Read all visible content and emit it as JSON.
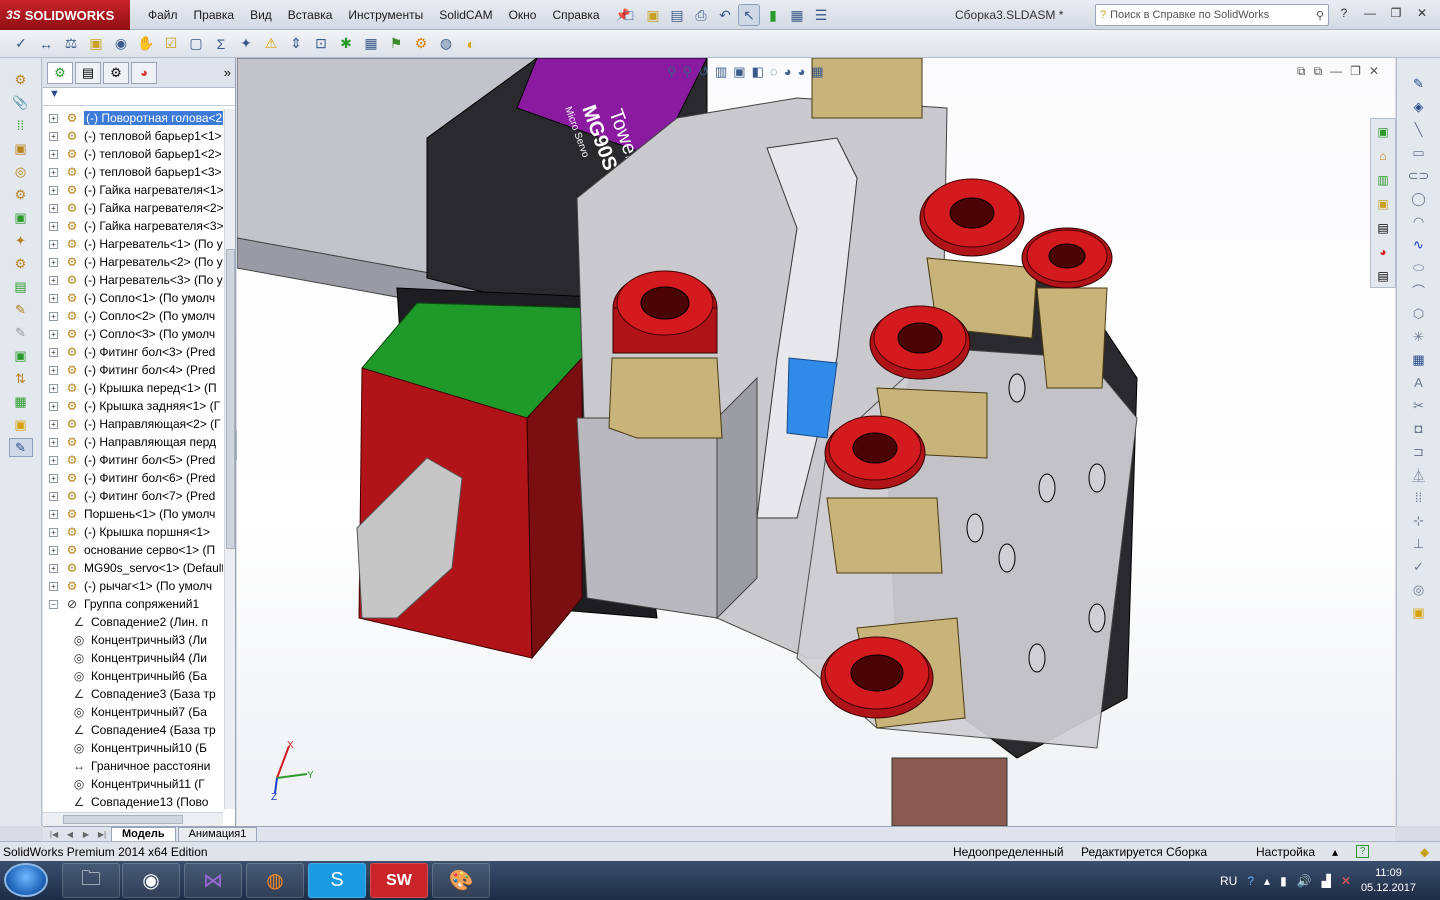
{
  "app": {
    "brand": "SOLIDWORKS",
    "brand_prefix": "3S",
    "document_title": "Сборка3.SLDASM *"
  },
  "menu": [
    "Файл",
    "Правка",
    "Вид",
    "Вставка",
    "Инструменты",
    "SolidCAM",
    "Окно",
    "Справка"
  ],
  "help_search": {
    "placeholder": "Поиск в Справке по SolidWorks"
  },
  "tree": {
    "filter_icon": "funnel-icon",
    "items": [
      {
        "label": "(-) Поворотная голова<2",
        "icon": "assembly-icon",
        "selected": true
      },
      {
        "label": "(-) тепловой барьер1<1>",
        "icon": "part-icon"
      },
      {
        "label": "(-) тепловой барьер1<2>",
        "icon": "part-icon"
      },
      {
        "label": "(-) тепловой барьер1<3>",
        "icon": "part-icon"
      },
      {
        "label": "(-) Гайка нагревателя<1>",
        "icon": "part-icon"
      },
      {
        "label": "(-) Гайка нагревателя<2>",
        "icon": "part-icon"
      },
      {
        "label": "(-) Гайка нагревателя<3>",
        "icon": "part-icon"
      },
      {
        "label": "(-) Нагреватель<1> (По у",
        "icon": "part-icon"
      },
      {
        "label": "(-) Нагреватель<2> (По у",
        "icon": "part-icon"
      },
      {
        "label": "(-) Нагреватель<3> (По у",
        "icon": "part-icon"
      },
      {
        "label": "(-) Сопло<1> (По умолч",
        "icon": "part-icon"
      },
      {
        "label": "(-) Сопло<2> (По умолч",
        "icon": "part-icon"
      },
      {
        "label": "(-) Сопло<3> (По умолч",
        "icon": "part-icon"
      },
      {
        "label": "(-) Фитинг бол<3> (Pred",
        "icon": "part-icon"
      },
      {
        "label": "(-) Фитинг бол<4> (Pred",
        "icon": "part-icon"
      },
      {
        "label": "(-) Крышка перед<1> (П",
        "icon": "part-icon"
      },
      {
        "label": "(-) Крышка задняя<1> (Г",
        "icon": "part-icon"
      },
      {
        "label": "(-) Направляющая<2> (Г",
        "icon": "part-icon"
      },
      {
        "label": "(-) Направляющая перд",
        "icon": "part-icon"
      },
      {
        "label": "(-) Фитинг бол<5> (Pred",
        "icon": "part-icon"
      },
      {
        "label": "(-) Фитинг бол<6> (Pred",
        "icon": "part-icon"
      },
      {
        "label": "(-) Фитинг бол<7> (Pred",
        "icon": "part-icon"
      },
      {
        "label": "Поршень<1> (По умолч",
        "icon": "part-icon"
      },
      {
        "label": "(-) Крышка поршня<1>",
        "icon": "part-icon"
      },
      {
        "label": "основание серво<1> (П",
        "icon": "part-icon"
      },
      {
        "label": "MG90s_servo<1> (Default",
        "icon": "part-icon"
      },
      {
        "label": "(-) рычаг<1> (По умолч",
        "icon": "part-icon"
      },
      {
        "label": "Группа сопряжений1",
        "icon": "mates-icon",
        "expanded": true
      }
    ],
    "mates": [
      {
        "label": "Совпадение2 (Лин. п",
        "icon": "coincident-icon"
      },
      {
        "label": "Концентричный3 (Ли",
        "icon": "concentric-icon"
      },
      {
        "label": "Концентричный4 (Ли",
        "icon": "concentric-icon"
      },
      {
        "label": "Концентричный6 (Ба",
        "icon": "concentric-icon"
      },
      {
        "label": "Совпадение3 (База тр",
        "icon": "coincident-icon"
      },
      {
        "label": "Концентричный7 (Ба",
        "icon": "concentric-icon"
      },
      {
        "label": "Совпадение4 (База тр",
        "icon": "coincident-icon"
      },
      {
        "label": "Концентричный10 (Б",
        "icon": "concentric-icon"
      },
      {
        "label": "Граничное расстояни",
        "icon": "distance-icon"
      },
      {
        "label": "Концентричный11 (Г",
        "icon": "concentric-icon"
      },
      {
        "label": "Совпадение13 (Пово",
        "icon": "coincident-icon"
      }
    ]
  },
  "viewport": {
    "servo_label_brand": "Tower Pro",
    "servo_label_model": "MG90S",
    "servo_label_sub": "Micro Servo",
    "triad": {
      "x": "X",
      "y": "Y",
      "z": "Z"
    }
  },
  "bottom_tabs": [
    "Модель",
    "Анимация1"
  ],
  "status": {
    "edition": "SolidWorks Premium 2014 x64 Edition",
    "state": "Недоопределенный",
    "mode": "Редактируется Сборка",
    "settings": "Настройка"
  },
  "tray": {
    "lang": "RU",
    "time": "11:09",
    "date": "05.12.2017"
  },
  "colors": {
    "brand_red": "#c8242a",
    "selection_blue": "#3d7bd9",
    "fitting_red": "#c2161b",
    "fitting_brass": "#c8b47a",
    "body_grey": "#c9c9ce",
    "plate_black": "#2a2a2e",
    "servo_purple": "#8a1aa0",
    "block_green": "#1f9a2a"
  }
}
